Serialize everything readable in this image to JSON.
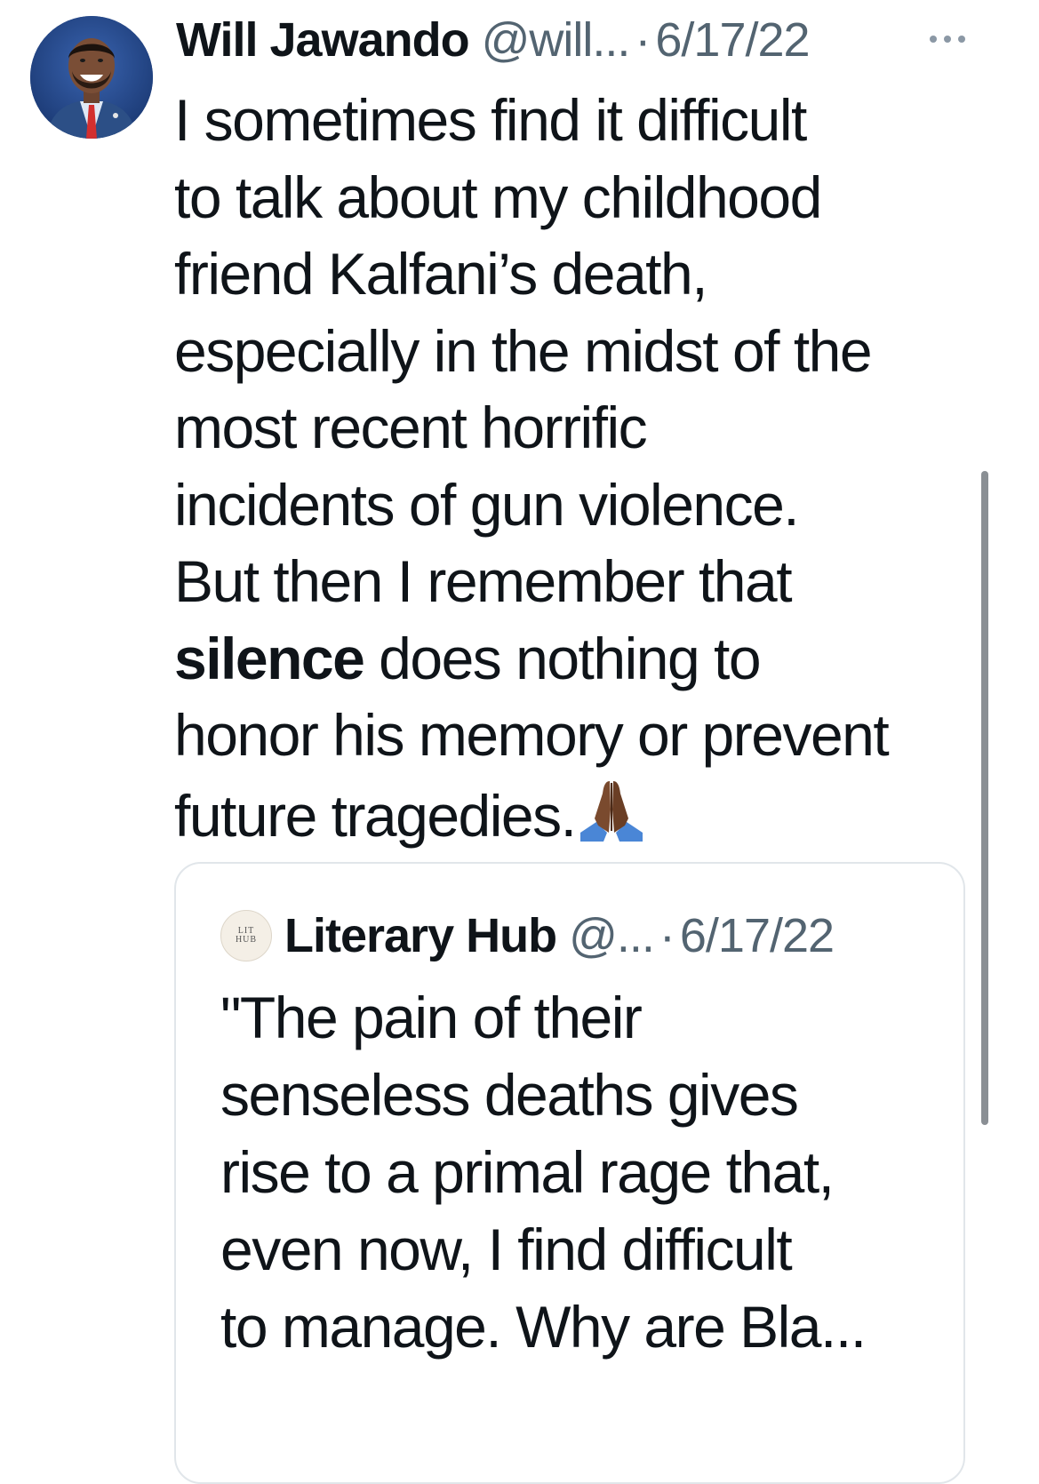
{
  "tweet": {
    "author_name": "Will Jawando",
    "handle": "@will...",
    "separator": "·",
    "date": "6/17/22",
    "text_lines": [
      "I sometimes find it difficult",
      "to talk about my childhood",
      "friend Kalfani’s death,",
      "especially in the midst of the",
      "most recent horrific",
      "incidents of gun violence.",
      "But then I remember that"
    ],
    "bold_word": "silence",
    "after_bold": " does nothing to",
    "text_line_9": "honor his memory or prevent",
    "last_line": "future tragedies.",
    "emoji_icon": "folded-hands-icon"
  },
  "quoted_tweet": {
    "avatar_text_top": "LIT",
    "avatar_text_bottom": "HUB",
    "author_name": "Literary Hub",
    "handle": "@...",
    "separator": "·",
    "date": "6/17/22",
    "text_lines": [
      "\"The pain of their",
      "senseless deaths gives",
      "rise to a primal rage that,",
      "even now, I find difficult",
      "to manage. Why are Bla..."
    ]
  },
  "colors": {
    "text_primary": "#0f1419",
    "text_secondary": "#536471",
    "border": "#e1e6ea",
    "scrollbar": "#8a8f94"
  }
}
